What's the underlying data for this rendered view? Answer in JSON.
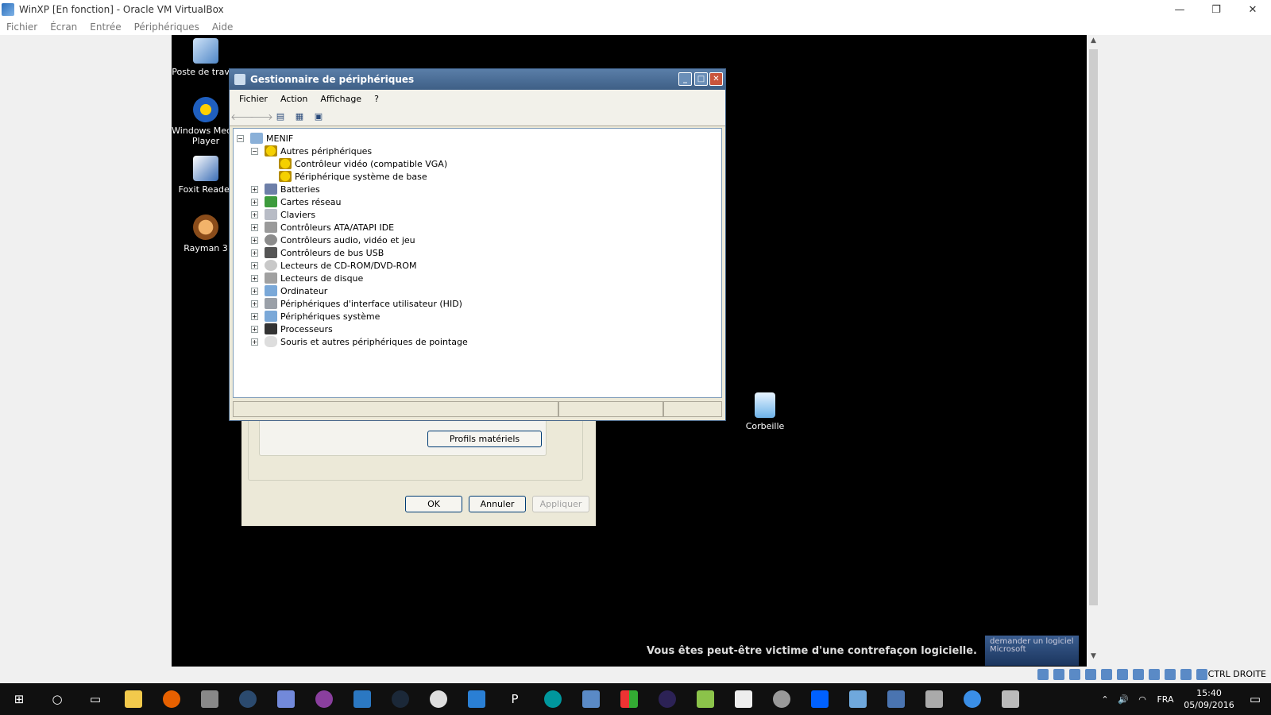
{
  "vbox": {
    "title": "WinXP [En fonction] - Oracle VM VirtualBox",
    "menu": [
      "Fichier",
      "Écran",
      "Entrée",
      "Périphériques",
      "Aide"
    ],
    "hostkey": "CTRL DROITE"
  },
  "desktop": {
    "icons": [
      {
        "label": "Poste de travail"
      },
      {
        "label": "Windows Media Player"
      },
      {
        "label": "Foxit Reader"
      },
      {
        "label": "Rayman 3"
      },
      {
        "label": "Corbeille"
      }
    ],
    "counterfeit_text": "Vous êtes peut-être victime d'une contrefaçon logicielle.",
    "counterfeit_badge": "demander un logiciel Microsoft"
  },
  "devmgr": {
    "title": "Gestionnaire de périphériques",
    "menu": [
      "Fichier",
      "Action",
      "Affichage",
      "?"
    ],
    "root": "MENIF",
    "other_devices": "Autres périphériques",
    "other_children": [
      "Contrôleur vidéo (compatible VGA)",
      "Périphérique système de base"
    ],
    "categories": [
      "Batteries",
      "Cartes réseau",
      "Claviers",
      "Contrôleurs ATA/ATAPI IDE",
      "Contrôleurs audio, vidéo et jeu",
      "Contrôleurs de bus USB",
      "Lecteurs de CD-ROM/DVD-ROM",
      "Lecteurs de disque",
      "Ordinateur",
      "Périphériques d'interface utilisateur (HID)",
      "Périphériques système",
      "Processeurs",
      "Souris et autres périphériques de pointage"
    ]
  },
  "sysprops": {
    "profiles_button": "Profils matériels",
    "ok": "OK",
    "cancel": "Annuler",
    "apply": "Appliquer"
  },
  "tray": {
    "lang": "FRA",
    "time": "15:40",
    "date": "05/09/2016"
  },
  "colors": {
    "xp_title": "#3e5f86",
    "vm_bg": "#000000",
    "taskbar": "#101010"
  }
}
